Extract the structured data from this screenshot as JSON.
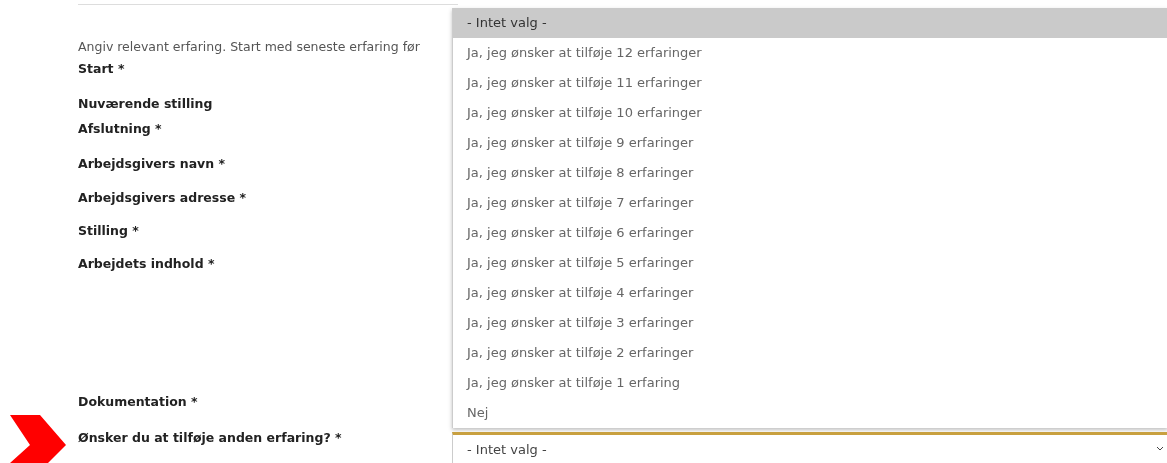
{
  "intro": "Angiv relevant erfaring. Start med seneste erfaring før",
  "labels": [
    "Start *",
    "Nuværende stilling",
    "Afslutning *",
    "Arbejdsgivers navn *",
    "Arbejdsgivers adresse *",
    "Stilling *",
    "Arbejdets indhold *",
    "Dokumentation *",
    "Ønsker du at tilføje anden erfaring? *"
  ],
  "dropdown": {
    "options": [
      {
        "label": "- Intet valg -",
        "selected": true
      },
      {
        "label": "Ja, jeg ønsker at tilføje 12 erfaringer",
        "selected": false
      },
      {
        "label": "Ja, jeg ønsker at tilføje 11 erfaringer",
        "selected": false
      },
      {
        "label": "Ja, jeg ønsker at tilføje 10 erfaringer",
        "selected": false
      },
      {
        "label": "Ja, jeg ønsker at tilføje 9 erfaringer",
        "selected": false
      },
      {
        "label": "Ja, jeg ønsker at tilføje 8 erfaringer",
        "selected": false
      },
      {
        "label": "Ja, jeg ønsker at tilføje 7 erfaringer",
        "selected": false
      },
      {
        "label": "Ja, jeg ønsker at tilføje 6 erfaringer",
        "selected": false
      },
      {
        "label": "Ja, jeg ønsker at tilføje 5 erfaringer",
        "selected": false
      },
      {
        "label": "Ja, jeg ønsker at tilføje 4 erfaringer",
        "selected": false
      },
      {
        "label": "Ja, jeg ønsker at tilføje 3 erfaringer",
        "selected": false
      },
      {
        "label": "Ja, jeg ønsker at tilføje 2 erfaringer",
        "selected": false
      },
      {
        "label": "Ja, jeg ønsker at tilføje 1 erfaring",
        "selected": false
      },
      {
        "label": "Nej",
        "selected": false
      }
    ],
    "value": "- Intet valg -"
  }
}
